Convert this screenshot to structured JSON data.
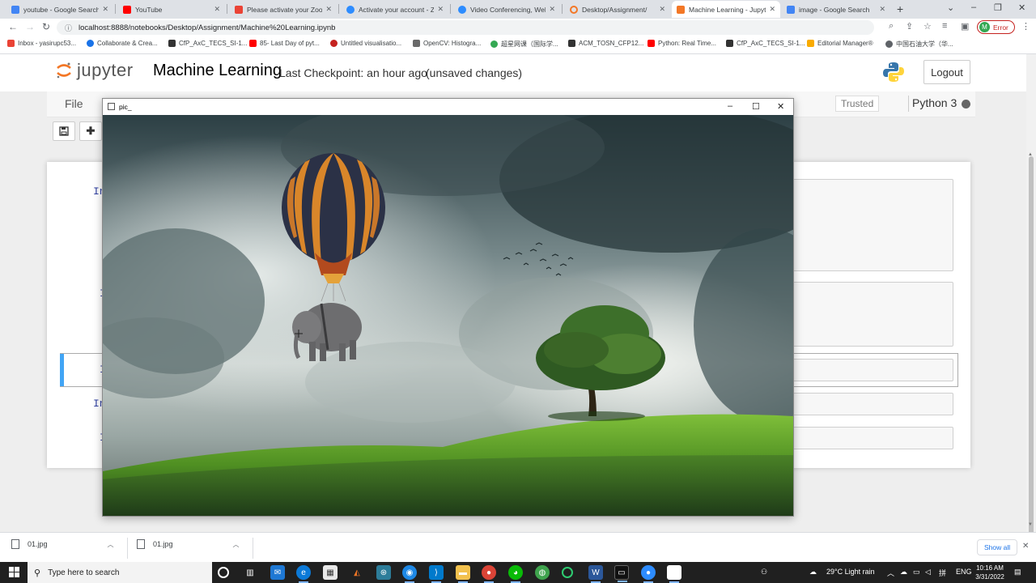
{
  "browser": {
    "tabs": [
      {
        "title": "youtube - Google Search",
        "icon": "google-icon",
        "color": "#4285f4",
        "active": false
      },
      {
        "title": "YouTube",
        "icon": "youtube-icon",
        "color": "#ff0000",
        "active": false
      },
      {
        "title": "Please activate your Zoom a",
        "icon": "gmail-icon",
        "color": "#ea4335",
        "active": false
      },
      {
        "title": "Activate your account - Zo",
        "icon": "zoom-icon",
        "color": "#2d8cff",
        "active": false
      },
      {
        "title": "Video Conferencing, Web",
        "icon": "zoom-icon",
        "color": "#2d8cff",
        "active": false
      },
      {
        "title": "Desktop/Assignment/",
        "icon": "jupyter-icon",
        "color": "#f37726",
        "active": false
      },
      {
        "title": "Machine Learning - Jupyte",
        "icon": "jupyter-icon",
        "color": "#f37726",
        "active": true
      },
      {
        "title": "image - Google Search",
        "icon": "google-icon",
        "color": "#4285f4",
        "active": false
      }
    ],
    "url": "localhost:8888/notebooks/Desktop/Assignment/Machine%20Learning.ipynb",
    "profile_letter": "M",
    "profile_status": "Error",
    "bookmarks": [
      {
        "label": "Inbox - yasirupc53...",
        "color": "#ea4335"
      },
      {
        "label": "Collaborate & Crea...",
        "color": "#1a73e8"
      },
      {
        "label": "CfP_AxC_TECS_SI-1...",
        "color": "#333333"
      },
      {
        "label": "85- Last Day of pyt...",
        "color": "#ff0000"
      },
      {
        "label": "Untitled visualisatio...",
        "color": "#c5221f"
      },
      {
        "label": "OpenCV: Histogra...",
        "color": "#6a6a6a"
      },
      {
        "label": "超星网课（国际学...",
        "color": "#34a853"
      },
      {
        "label": "ACM_TOSN_CFP12...",
        "color": "#333333"
      },
      {
        "label": "Python: Real Time...",
        "color": "#ff0000"
      },
      {
        "label": "CfP_AxC_TECS_SI-1...",
        "color": "#333333"
      },
      {
        "label": "Editorial Manager®",
        "color": "#f9ab00"
      },
      {
        "label": "中国石油大学（华...",
        "color": "#5f6368"
      }
    ]
  },
  "jupyter": {
    "logo_text": "jupyter",
    "notebook_title": "Machine Learning",
    "checkpoint": "Last Checkpoint: an hour ago",
    "status": "(unsaved changes)",
    "logout": "Logout",
    "menu_file": "File",
    "trusted": "Trusted",
    "kernel": "Python 3",
    "cells": [
      {
        "prompt": "In"
      },
      {
        "prompt": "I"
      },
      {
        "prompt": "I"
      },
      {
        "prompt": "In"
      },
      {
        "prompt": "I"
      }
    ]
  },
  "viewer": {
    "title": "pic_"
  },
  "downloads": {
    "items": [
      "01.jpg",
      "01.jpg"
    ],
    "show_all": "Show all"
  },
  "taskbar": {
    "search_placeholder": "Type here to search",
    "weather": "29°C  Light rain",
    "language": "ENG",
    "time": "10:16 AM",
    "date": "3/31/2022"
  }
}
